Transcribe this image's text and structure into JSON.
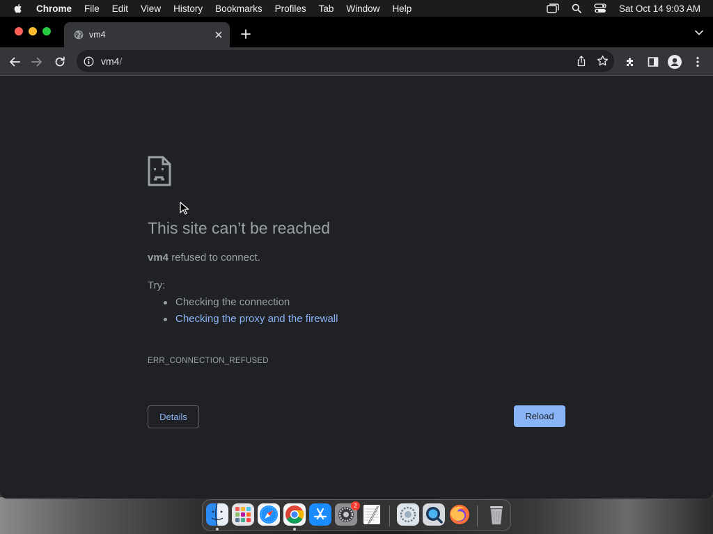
{
  "menubar": {
    "app_name": "Chrome",
    "items": [
      "File",
      "Edit",
      "View",
      "History",
      "Bookmarks",
      "Profiles",
      "Tab",
      "Window",
      "Help"
    ],
    "clock": "Sat Oct 14  9:03 AM"
  },
  "browser": {
    "tab_title": "vm4",
    "url_host": "vm4",
    "url_path": "/"
  },
  "error_page": {
    "heading": "This site can’t be reached",
    "host": "vm4",
    "message": " refused to connect.",
    "try_label": "Try:",
    "suggestions": [
      "Checking the connection",
      "Checking the proxy and the firewall"
    ],
    "error_code": "ERR_CONNECTION_REFUSED",
    "details_label": "Details",
    "reload_label": "Reload"
  },
  "dock": {
    "apps": [
      "finder-icon",
      "launchpad-icon",
      "safari-icon",
      "chrome-icon",
      "app-store-icon",
      "system-settings-icon",
      "textedit-icon",
      "preview-icon",
      "quicktime-icon",
      "firefox-icon",
      "trash-icon"
    ],
    "settings_badge": "2"
  },
  "colors": {
    "link": "#8ab4f8",
    "page_bg": "#202124",
    "toolbar_bg": "#35363a"
  }
}
